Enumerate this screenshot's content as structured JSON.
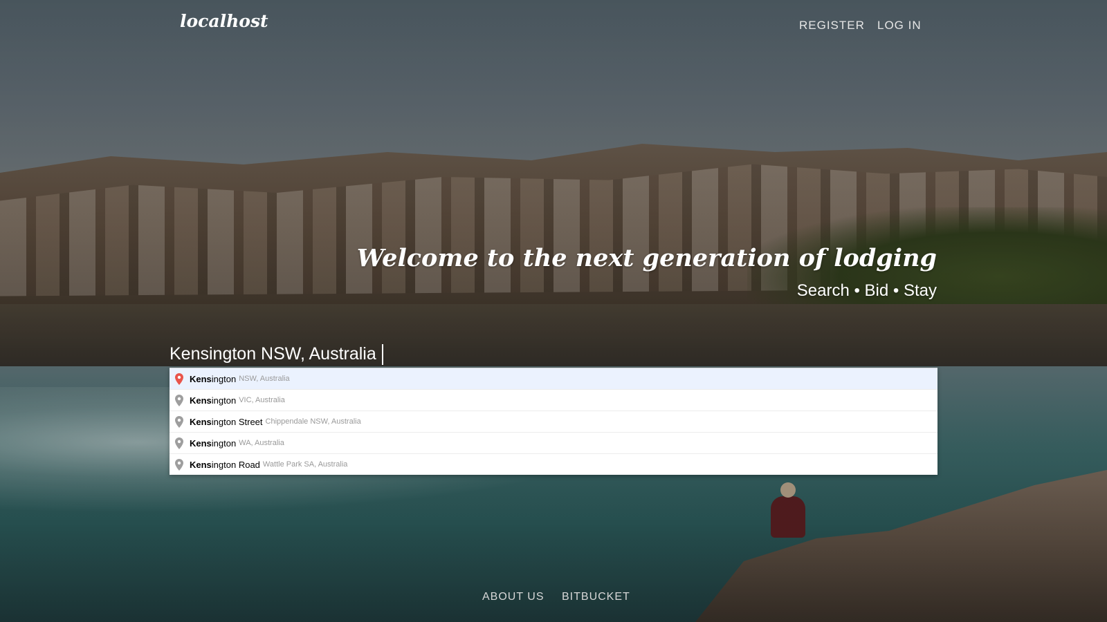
{
  "header": {
    "brand": "localhost",
    "nav": [
      {
        "label": "REGISTER"
      },
      {
        "label": "LOG IN"
      }
    ]
  },
  "hero": {
    "title": "Welcome to the next generation of lodging",
    "subtitle": "Search • Bid • Stay"
  },
  "search": {
    "value": "Kensington NSW, Australia",
    "suggestions": [
      {
        "match": "Kens",
        "rest": "ington",
        "secondary": "NSW, Australia",
        "active": true
      },
      {
        "match": "Kens",
        "rest": "ington",
        "secondary": "VIC, Australia",
        "active": false
      },
      {
        "match": "Kens",
        "rest": "ington Street",
        "secondary": "Chippendale NSW, Australia",
        "active": false
      },
      {
        "match": "Kens",
        "rest": "ington",
        "secondary": "WA, Australia",
        "active": false
      },
      {
        "match": "Kens",
        "rest": "ington Road",
        "secondary": "Wattle Park SA, Australia",
        "active": false
      }
    ],
    "pin_icon": "map-pin-icon",
    "pin_color_active": "#e9544a",
    "pin_color_default": "#9e9e9e"
  },
  "footer": {
    "links": [
      {
        "label": "ABOUT US"
      },
      {
        "label": "BITBUCKET"
      }
    ]
  }
}
